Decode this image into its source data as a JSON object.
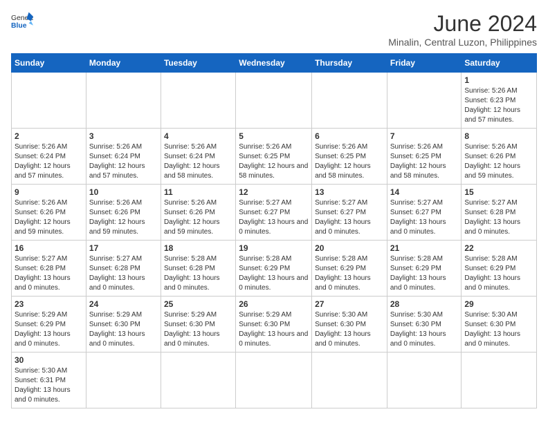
{
  "header": {
    "logo_general": "General",
    "logo_blue": "Blue",
    "month_title": "June 2024",
    "location": "Minalin, Central Luzon, Philippines"
  },
  "weekdays": [
    "Sunday",
    "Monday",
    "Tuesday",
    "Wednesday",
    "Thursday",
    "Friday",
    "Saturday"
  ],
  "weeks": [
    [
      {
        "day": "",
        "info": ""
      },
      {
        "day": "",
        "info": ""
      },
      {
        "day": "",
        "info": ""
      },
      {
        "day": "",
        "info": ""
      },
      {
        "day": "",
        "info": ""
      },
      {
        "day": "",
        "info": ""
      },
      {
        "day": "1",
        "info": "Sunrise: 5:26 AM\nSunset: 6:23 PM\nDaylight: 12 hours and 57 minutes."
      }
    ],
    [
      {
        "day": "2",
        "info": "Sunrise: 5:26 AM\nSunset: 6:24 PM\nDaylight: 12 hours and 57 minutes."
      },
      {
        "day": "3",
        "info": "Sunrise: 5:26 AM\nSunset: 6:24 PM\nDaylight: 12 hours and 57 minutes."
      },
      {
        "day": "4",
        "info": "Sunrise: 5:26 AM\nSunset: 6:24 PM\nDaylight: 12 hours and 58 minutes."
      },
      {
        "day": "5",
        "info": "Sunrise: 5:26 AM\nSunset: 6:25 PM\nDaylight: 12 hours and 58 minutes."
      },
      {
        "day": "6",
        "info": "Sunrise: 5:26 AM\nSunset: 6:25 PM\nDaylight: 12 hours and 58 minutes."
      },
      {
        "day": "7",
        "info": "Sunrise: 5:26 AM\nSunset: 6:25 PM\nDaylight: 12 hours and 58 minutes."
      },
      {
        "day": "8",
        "info": "Sunrise: 5:26 AM\nSunset: 6:26 PM\nDaylight: 12 hours and 59 minutes."
      }
    ],
    [
      {
        "day": "9",
        "info": "Sunrise: 5:26 AM\nSunset: 6:26 PM\nDaylight: 12 hours and 59 minutes."
      },
      {
        "day": "10",
        "info": "Sunrise: 5:26 AM\nSunset: 6:26 PM\nDaylight: 12 hours and 59 minutes."
      },
      {
        "day": "11",
        "info": "Sunrise: 5:26 AM\nSunset: 6:26 PM\nDaylight: 12 hours and 59 minutes."
      },
      {
        "day": "12",
        "info": "Sunrise: 5:27 AM\nSunset: 6:27 PM\nDaylight: 13 hours and 0 minutes."
      },
      {
        "day": "13",
        "info": "Sunrise: 5:27 AM\nSunset: 6:27 PM\nDaylight: 13 hours and 0 minutes."
      },
      {
        "day": "14",
        "info": "Sunrise: 5:27 AM\nSunset: 6:27 PM\nDaylight: 13 hours and 0 minutes."
      },
      {
        "day": "15",
        "info": "Sunrise: 5:27 AM\nSunset: 6:28 PM\nDaylight: 13 hours and 0 minutes."
      }
    ],
    [
      {
        "day": "16",
        "info": "Sunrise: 5:27 AM\nSunset: 6:28 PM\nDaylight: 13 hours and 0 minutes."
      },
      {
        "day": "17",
        "info": "Sunrise: 5:27 AM\nSunset: 6:28 PM\nDaylight: 13 hours and 0 minutes."
      },
      {
        "day": "18",
        "info": "Sunrise: 5:28 AM\nSunset: 6:28 PM\nDaylight: 13 hours and 0 minutes."
      },
      {
        "day": "19",
        "info": "Sunrise: 5:28 AM\nSunset: 6:29 PM\nDaylight: 13 hours and 0 minutes."
      },
      {
        "day": "20",
        "info": "Sunrise: 5:28 AM\nSunset: 6:29 PM\nDaylight: 13 hours and 0 minutes."
      },
      {
        "day": "21",
        "info": "Sunrise: 5:28 AM\nSunset: 6:29 PM\nDaylight: 13 hours and 0 minutes."
      },
      {
        "day": "22",
        "info": "Sunrise: 5:28 AM\nSunset: 6:29 PM\nDaylight: 13 hours and 0 minutes."
      }
    ],
    [
      {
        "day": "23",
        "info": "Sunrise: 5:29 AM\nSunset: 6:29 PM\nDaylight: 13 hours and 0 minutes."
      },
      {
        "day": "24",
        "info": "Sunrise: 5:29 AM\nSunset: 6:30 PM\nDaylight: 13 hours and 0 minutes."
      },
      {
        "day": "25",
        "info": "Sunrise: 5:29 AM\nSunset: 6:30 PM\nDaylight: 13 hours and 0 minutes."
      },
      {
        "day": "26",
        "info": "Sunrise: 5:29 AM\nSunset: 6:30 PM\nDaylight: 13 hours and 0 minutes."
      },
      {
        "day": "27",
        "info": "Sunrise: 5:30 AM\nSunset: 6:30 PM\nDaylight: 13 hours and 0 minutes."
      },
      {
        "day": "28",
        "info": "Sunrise: 5:30 AM\nSunset: 6:30 PM\nDaylight: 13 hours and 0 minutes."
      },
      {
        "day": "29",
        "info": "Sunrise: 5:30 AM\nSunset: 6:30 PM\nDaylight: 13 hours and 0 minutes."
      }
    ],
    [
      {
        "day": "30",
        "info": "Sunrise: 5:30 AM\nSunset: 6:31 PM\nDaylight: 13 hours and 0 minutes."
      },
      {
        "day": "",
        "info": ""
      },
      {
        "day": "",
        "info": ""
      },
      {
        "day": "",
        "info": ""
      },
      {
        "day": "",
        "info": ""
      },
      {
        "day": "",
        "info": ""
      },
      {
        "day": "",
        "info": ""
      }
    ]
  ]
}
